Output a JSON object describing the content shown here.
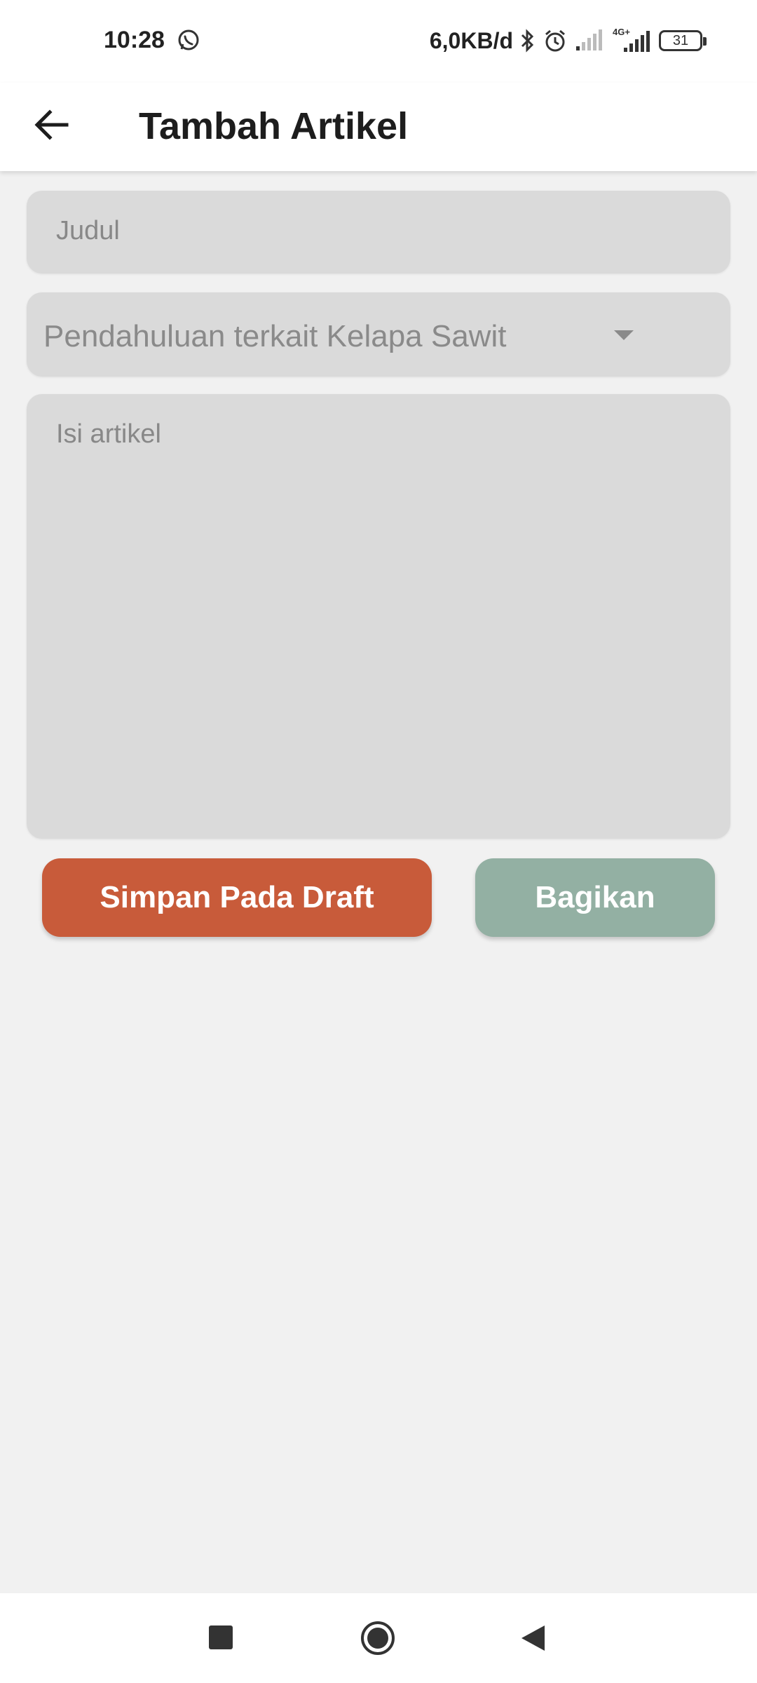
{
  "status_bar": {
    "time": "10:28",
    "net_speed": "6,0KB/d",
    "network": "4G+",
    "battery": "31",
    "icons": [
      "whatsapp-icon",
      "bluetooth-icon",
      "alarm-icon",
      "signal-icon",
      "signal-4g-icon",
      "battery-icon"
    ]
  },
  "app_bar": {
    "title": "Tambah Artikel",
    "back_icon": "arrow-left-icon"
  },
  "form": {
    "title_placeholder": "Judul",
    "category_value": "Pendahuluan terkait Kelapa Sawit",
    "body_placeholder": "Isi artikel"
  },
  "buttons": {
    "draft_label": "Simpan Pada Draft",
    "share_label": "Bagikan"
  },
  "colors": {
    "draft_button": "#c85b3a",
    "share_button": "#93b0a3",
    "field_bg": "#dadada",
    "page_bg": "#f1f1f1"
  },
  "nav_bar": {
    "icons": [
      "recent-apps-icon",
      "home-icon",
      "back-icon"
    ]
  }
}
